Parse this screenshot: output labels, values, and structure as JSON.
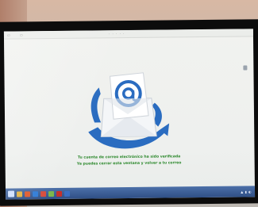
{
  "screen": {
    "caption_line1": "Tu cuenta de correo electrónico ha sido verificada",
    "caption_line2": "Ya puedes cerrar esta ventana y volver a tu correo"
  },
  "taskbar": {
    "icons": [
      {
        "name": "start-button-icon",
        "color": "#cfe0ff"
      },
      {
        "name": "folder-icon",
        "color": "#e3b341"
      },
      {
        "name": "media-player-icon",
        "color": "#e05a2b"
      },
      {
        "name": "browser-icon",
        "color": "#2e7bd6"
      },
      {
        "name": "chrome-icon",
        "color": "#d64a3a"
      },
      {
        "name": "app-icon",
        "color": "#7ab648"
      },
      {
        "name": "pdf-icon",
        "color": "#c7302a"
      },
      {
        "name": "mail-icon",
        "color": "#3a6fc4"
      }
    ]
  },
  "colors": {
    "email_blue": "#1f6fc1",
    "caption_green": "#2f8a2f",
    "taskbar_blue": "#3a5c94"
  }
}
